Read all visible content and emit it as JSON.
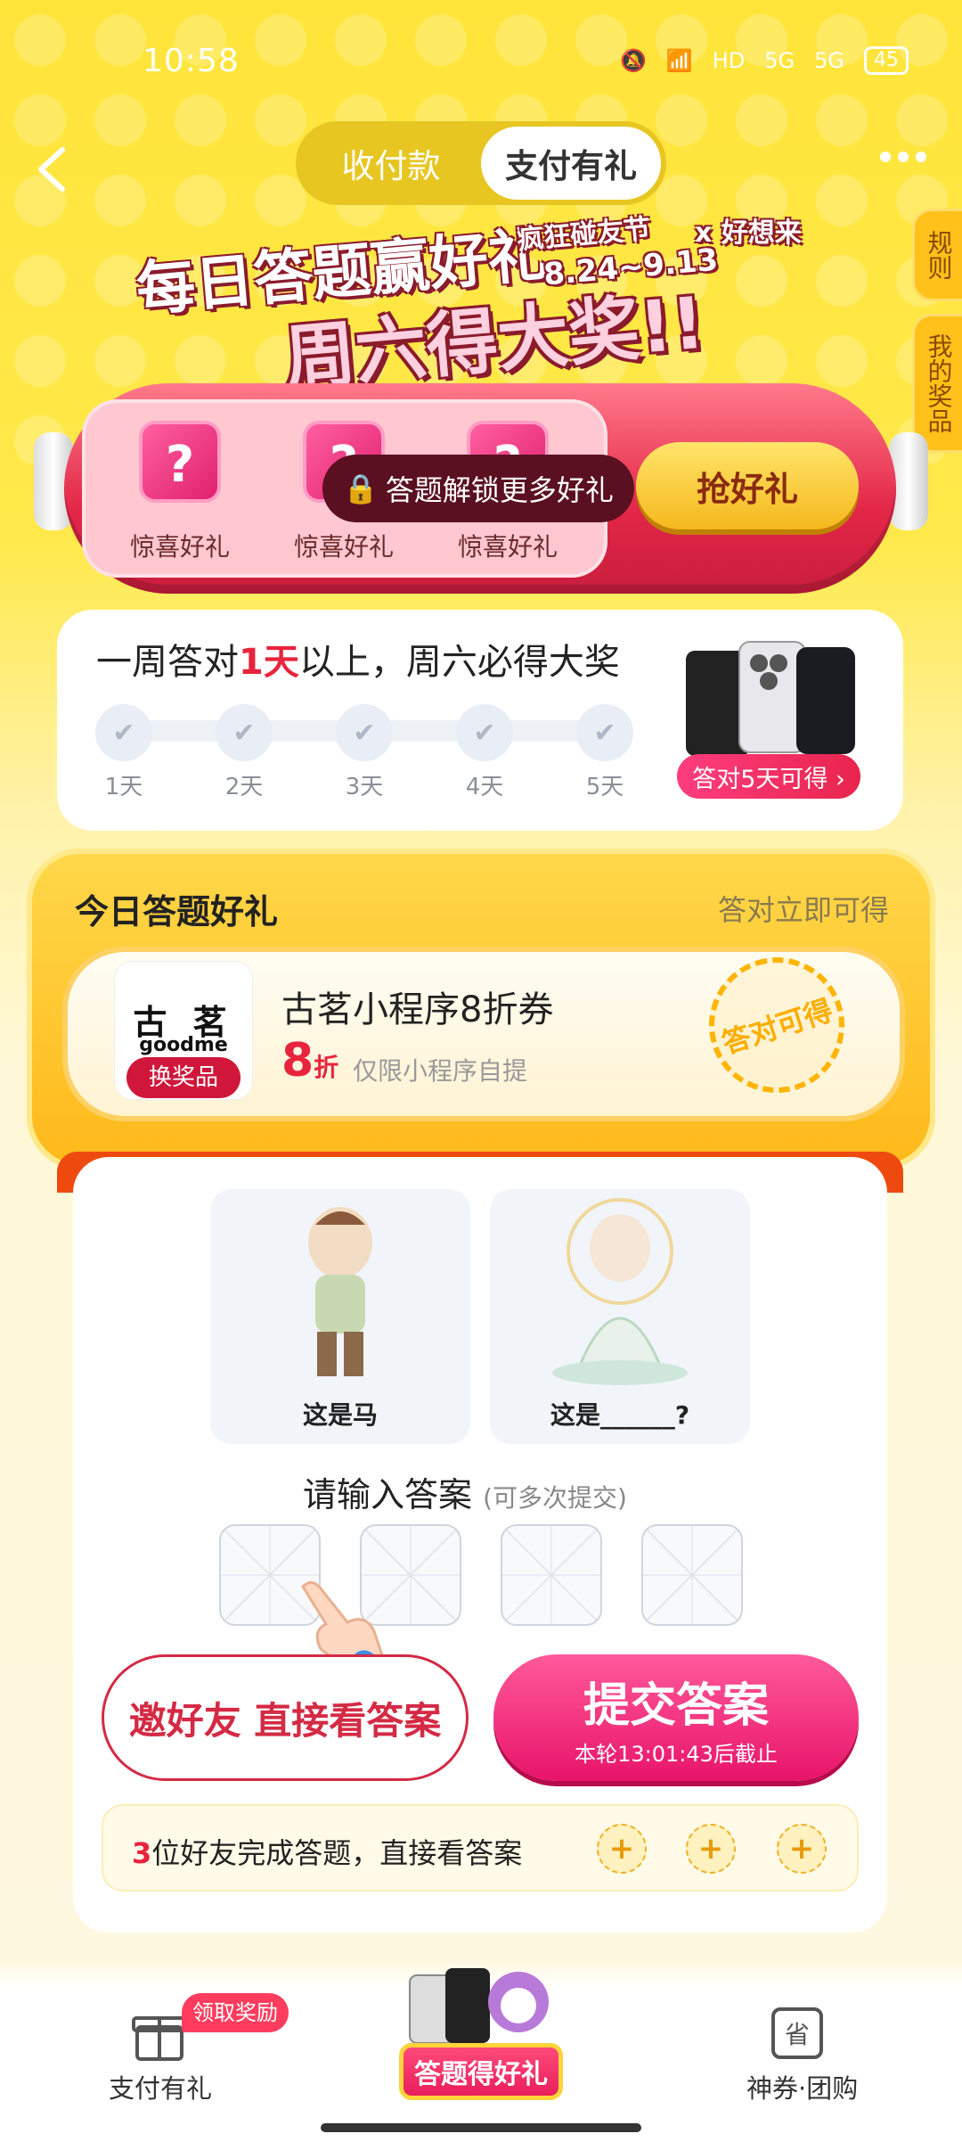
{
  "status": {
    "time": "10:58",
    "network1": "5G",
    "network2": "5G",
    "hd": "HD",
    "battery": "45"
  },
  "nav": {
    "tab_collect": "收付款",
    "tab_pay_gift": "支付有礼"
  },
  "banner": {
    "title_line1": "每日答题赢好礼",
    "title_line2": "周六得大奖!!",
    "festival": "疯狂碰友节",
    "collab": "x 好想来",
    "dates": "8.24~9.13"
  },
  "side": {
    "rules": "规则",
    "my_prizes": "我的奖品"
  },
  "capsule": {
    "gifts": [
      {
        "label": "惊喜好礼"
      },
      {
        "label": "惊喜好礼"
      },
      {
        "label": "惊喜好礼"
      }
    ],
    "lock_text": "答题解锁更多好礼",
    "grab_button": "抢好礼"
  },
  "progress": {
    "title_pre": "一周答对",
    "title_num": "1天",
    "title_post": "以上，周六必得大奖",
    "days": [
      "1天",
      "2天",
      "3天",
      "4天",
      "5天"
    ],
    "reward_tag": "答对5天可得 ›"
  },
  "today": {
    "title": "今日答题好礼",
    "right_hint": "答对立即可得",
    "coupon": {
      "logo_cn": "古 茗",
      "logo_en": "goodme",
      "swap_label": "换奖品",
      "name": "古茗小程序8折券",
      "discount_num": "8",
      "discount_unit": "折",
      "note": "仅限小程序自提",
      "stamp": "答对可得"
    }
  },
  "quiz": {
    "pic1_caption": "这是马",
    "pic2_caption": "这是______?",
    "prompt": "请输入答案",
    "prompt_hint": "(可多次提交)",
    "invite_button": "邀好友 直接看答案",
    "submit_main": "提交答案",
    "submit_sub": "本轮13:01:43后截止",
    "friends_num": "3",
    "friends_text": "位好友完成答题，直接看答案"
  },
  "bottom_nav": {
    "left_label": "支付有礼",
    "left_badge": "领取奖励",
    "center_label": "答题得好礼",
    "right_label": "神券·团购"
  }
}
